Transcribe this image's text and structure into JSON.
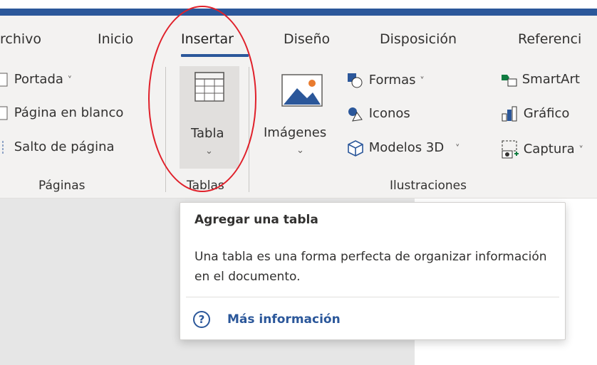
{
  "tabs": [
    {
      "label": "rchivo"
    },
    {
      "label": "Inicio"
    },
    {
      "label": "Insertar",
      "active": true
    },
    {
      "label": "Diseño"
    },
    {
      "label": "Disposición"
    },
    {
      "label": "Referenci"
    }
  ],
  "groups": {
    "paginas": {
      "label": "Páginas",
      "items": [
        "Portada",
        "Página en blanco",
        "Salto de página"
      ]
    },
    "tablas": {
      "label": "Tablas",
      "button": "Tabla"
    },
    "ilustraciones": {
      "label": "Ilustraciones",
      "imagenes": "Imágenes",
      "formas": "Formas",
      "iconos": "Iconos",
      "modelos3d": "Modelos 3D",
      "smartart": "SmartArt",
      "grafico": "Gráfico",
      "captura": "Captura"
    }
  },
  "tooltip": {
    "title": "Agregar una tabla",
    "body": "Una tabla es una forma perfecta de organizar información en el documento.",
    "link": "Más información",
    "help_glyph": "?"
  },
  "glyphs": {
    "chevron": "⌄",
    "small_chevron": "˅"
  },
  "colors": {
    "accent": "#2b579a",
    "annotation": "#e0202a"
  }
}
